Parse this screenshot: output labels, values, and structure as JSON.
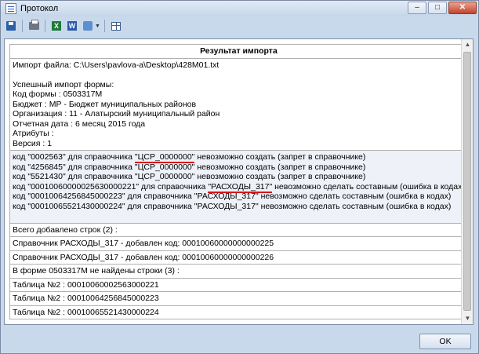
{
  "window": {
    "title": "Протокол"
  },
  "toolbar": {
    "icons": [
      "save-icon",
      "print-icon",
      "excel-icon",
      "word-icon",
      "export-icon",
      "table-icon"
    ],
    "excel_glyph": "X",
    "word_glyph": "W"
  },
  "report": {
    "header": "Результат импорта",
    "import_block": {
      "lines": [
        "Импорт файла: C:\\Users\\pavlova-a\\Desktop\\428M01.txt",
        "",
        "Успешный импорт формы:",
        "Код формы : 0503317M",
        "Бюджет : МР - Бюджет муниципальных районов",
        "Организация : 11 - Алатырский муниципальный район",
        "Отчетная дата : 6 месяц 2015 года",
        "Атрибуты :",
        "Версия : 1"
      ]
    },
    "errors": [
      {
        "pre": " код \"0002563\" для справочника ",
        "ref": "\"ЦСР_0000000\"",
        "post": " невозможно создать (запрет в справочнике)"
      },
      {
        "pre": "код \"4256845\" для справочника ",
        "ref": "\"ЦСР_0000000\"",
        "post": " невозможно создать (запрет в справочнике)"
      },
      {
        "pre": "код \"5521430\" для справочника ",
        "ref": "\"ЦСР_0000000\"",
        "post": " невозможно создать (запрет в справочнике)"
      },
      {
        "pre": "код \"00010060000025630000221\" для справочника ",
        "ref": "\"РАСХОДЫ_317\"",
        "post": " невозможно сделать составным (ошибка в кодах)"
      },
      {
        "pre": "код \"00010064256845000223\" для справочника ",
        "ref": "\"РАСХОДЫ_317\"",
        "post": " невозможно сделать составным (ошибка в кодах)"
      },
      {
        "pre": "код \"00010065521430000224\" для справочника ",
        "ref": "\"РАСХОДЫ_317\"",
        "post": " невозможно сделать составным (ошибка в кодах)"
      }
    ],
    "rows": [
      "Всего добавлено строк (2) :",
      "Справочник РАСХОДЫ_317 - добавлен код: 00010060000000000225",
      "Справочник РАСХОДЫ_317 - добавлен код: 00010060000000000226",
      "В форме 0503317M не найдены строки (3) :",
      "Таблица №2 : 00010060002563000221",
      "Таблица №2 : 00010064256845000223",
      "Таблица №2 : 00010065521430000224"
    ]
  },
  "footer": {
    "ok_label": "OK"
  },
  "colors": {
    "window_bg": "#c9d9ec",
    "underline": "#d4161c",
    "shaded_row": "#eef1f8"
  }
}
